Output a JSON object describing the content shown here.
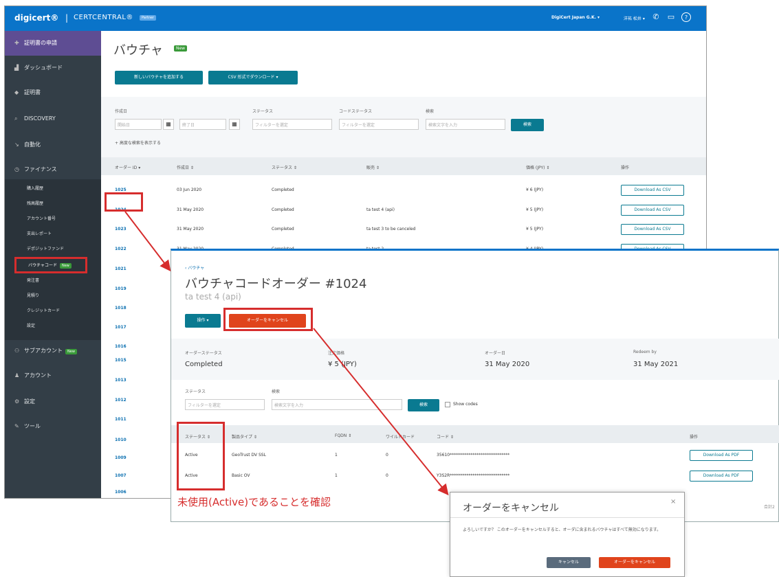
{
  "topbar": {
    "logo": "digicert®",
    "sep": "|",
    "product": "CERTCENTRAL®",
    "badge": "Partner",
    "org": "DigiCert Japan G.K. ▾",
    "user": "洋祐 松井 ▾"
  },
  "sidebar": {
    "top": "証明書の申請",
    "items": [
      "ダッシュボード",
      "証明書",
      "DISCOVERY",
      "自動化",
      "ファイナンス"
    ],
    "finance_sub": [
      "購入履歴",
      "残高履歴",
      "アカウント番号",
      "支出レポート",
      "デポジットファンド",
      "バウチャコード",
      "発注書",
      "見積り",
      "クレジットカード",
      "設定"
    ],
    "bottom": [
      "サブアカウント",
      "アカウント",
      "設定",
      "ツール"
    ],
    "new_label": "New"
  },
  "page1": {
    "title": "バウチャ",
    "new_label": "New",
    "add_button": "新しいバウチャを追加する",
    "csv_button": "CSV 形式でダウンロード ▾",
    "filters": {
      "created_label": "作成日",
      "start_placeholder": "開始日",
      "end_placeholder": "終了日",
      "status_label": "ステータス",
      "status_value": "フィルターを選定",
      "code_status_label": "コードステータス",
      "code_status_value": "フィルターを選定",
      "search_label": "検索",
      "search_placeholder": "検索文字を入力",
      "search_button": "検索",
      "advanced": "+ 高度な検索を表示する"
    },
    "columns": [
      "オーダー ID ▾",
      "作成日 ⇕",
      "ステータス ⇕",
      "販売 ⇕",
      "価格 (JPY) ⇕",
      "操作"
    ],
    "rows": [
      {
        "id": "1025",
        "date": "03 Jun 2020",
        "status": "Completed",
        "name": "",
        "price": "¥ 6 (JPY)",
        "action": "Download As CSV"
      },
      {
        "id": "1024",
        "date": "31 May 2020",
        "status": "Completed",
        "name": "ta test 4 (api)",
        "price": "¥ 5 (JPY)",
        "action": "Download As CSV"
      },
      {
        "id": "1023",
        "date": "31 May 2020",
        "status": "Completed",
        "name": "ta test 3 to be canceled",
        "price": "¥ 5 (JPY)",
        "action": "Download As CSV"
      },
      {
        "id": "1022",
        "date": "31 May 2020",
        "status": "Completed",
        "name": "ta test 2",
        "price": "¥ 4 (JPY)",
        "action": "Download As CSV"
      }
    ],
    "more_ids": [
      "1021",
      "1019",
      "1018",
      "1017",
      "1016",
      "1015",
      "1013",
      "1012",
      "1011",
      "1010",
      "1009",
      "1007",
      "1006"
    ]
  },
  "page2": {
    "breadcrumb": "‹ バウチャ",
    "title": "バウチャコードオーダー #1024",
    "subtitle": "ta test 4 (api)",
    "ops_button": "操作 ▾",
    "cancel_button": "オーダーをキャンセル",
    "summary": [
      {
        "label": "オーダーステータス",
        "value": "Completed"
      },
      {
        "label": "注文価格",
        "value": "¥ 5 (JPY)"
      },
      {
        "label": "オーダー日",
        "value": "31 May 2020"
      },
      {
        "label": "Redeem by",
        "value": "31 May 2021"
      }
    ],
    "status_label": "ステータス",
    "status_value": "フィルターを選定",
    "search_label": "検索",
    "search_placeholder": "検索文字を入力",
    "search_button": "検索",
    "show_codes": "Show codes",
    "columns": [
      "ステータス ⇕",
      "製品タイプ ⇕",
      "FQDN ⇕",
      "ワイルドカード",
      "コード ⇕",
      "操作"
    ],
    "rows": [
      {
        "status": "Active",
        "product": "GeoTrust DV SSL",
        "fqdn": "1",
        "wildcard": "0",
        "code": "35610*****************************",
        "action": "Download As PDF"
      },
      {
        "status": "Active",
        "product": "Basic OV",
        "fqdn": "1",
        "wildcard": "0",
        "code": "Y3S2R*****************************",
        "action": "Download As PDF"
      }
    ],
    "annotation": "未使用(Active)であることを確認",
    "pager": "合計2"
  },
  "modal": {
    "title": "オーダーをキャンセル",
    "close": "×",
    "body": "よろしいですか？ このオーダーをキャンセルすると、オーダに含まれるバウチャはすべて無効になります。",
    "cancel_label": "キャンセル",
    "confirm_label": "オーダーをキャンセル"
  },
  "colors": {
    "accent": "#0a74c9",
    "teal": "#0a7a91",
    "red_annotation": "#d62d2d",
    "danger": "#e0441c",
    "sidebar": "#333e47"
  }
}
